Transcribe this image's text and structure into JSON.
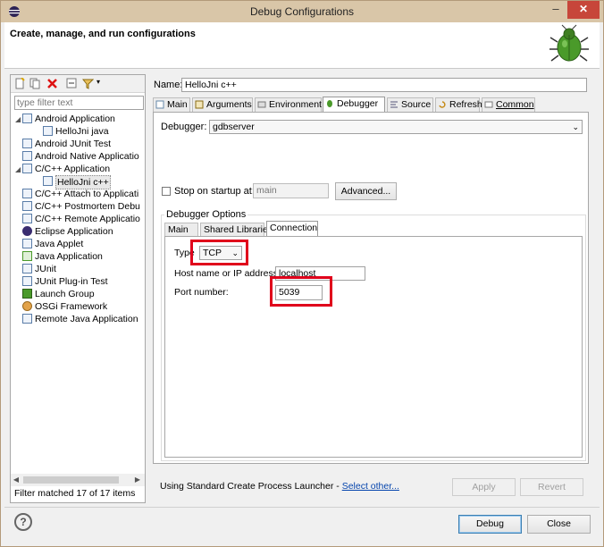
{
  "window": {
    "title": "Debug Configurations",
    "minimize": "–",
    "close": "✕"
  },
  "header": {
    "title": "Create, manage, and run configurations",
    "icon": "bug-icon"
  },
  "left": {
    "filter_placeholder": "type filter text",
    "tree": [
      {
        "label": "Android Application",
        "level": 0,
        "expanded": true
      },
      {
        "label": "HelloJni java",
        "level": 1
      },
      {
        "label": "Android JUnit Test",
        "level": 0
      },
      {
        "label": "Android Native Applicatio",
        "level": 0
      },
      {
        "label": "C/C++ Application",
        "level": 0,
        "expanded": true
      },
      {
        "label": "HelloJni c++",
        "level": 1,
        "selected": true
      },
      {
        "label": "C/C++ Attach to Applicati",
        "level": 0
      },
      {
        "label": "C/C++ Postmortem Debu",
        "level": 0
      },
      {
        "label": "C/C++ Remote Applicatio",
        "level": 0
      },
      {
        "label": "Eclipse Application",
        "level": 0
      },
      {
        "label": "Java Applet",
        "level": 0
      },
      {
        "label": "Java Application",
        "level": 0
      },
      {
        "label": "JUnit",
        "level": 0
      },
      {
        "label": "JUnit Plug-in Test",
        "level": 0
      },
      {
        "label": "Launch Group",
        "level": 0
      },
      {
        "label": "OSGi Framework",
        "level": 0
      },
      {
        "label": "Remote Java Application",
        "level": 0
      }
    ],
    "status": "Filter matched 17 of 17 items"
  },
  "right": {
    "name_label": "Name:",
    "name_value": "HelloJni c++",
    "tabs": [
      "Main",
      "Arguments",
      "Environment",
      "Debugger",
      "Source",
      "Refresh",
      "Common"
    ],
    "active_tab": "Debugger",
    "debugger_label": "Debugger:",
    "debugger_value": "gdbserver",
    "stop_on_startup_label": "Stop on startup at:",
    "stop_on_startup_value": "main",
    "advanced_button": "Advanced...",
    "options_label": "Debugger Options",
    "subtabs": [
      "Main",
      "Shared Libraries",
      "Connection"
    ],
    "active_subtab": "Connection",
    "type_label": "Type",
    "type_value": "TCP",
    "host_label": "Host name or IP address:",
    "host_value": "localhost",
    "port_label": "Port number:",
    "port_value": "5039",
    "launcher_text": "Using Standard Create Process Launcher - ",
    "launcher_link": "Select other...",
    "apply_button": "Apply",
    "revert_button": "Revert"
  },
  "footer": {
    "help": "?",
    "debug_button": "Debug",
    "close_button": "Close"
  }
}
